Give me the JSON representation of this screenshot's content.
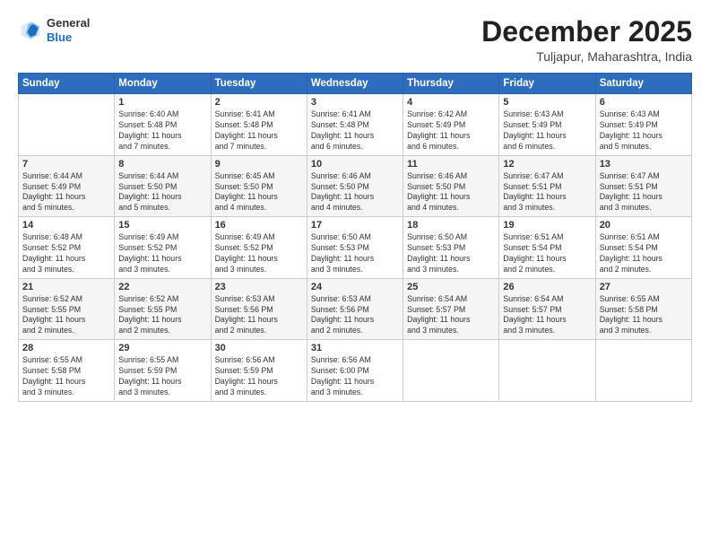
{
  "header": {
    "logo_line1": "General",
    "logo_line2": "Blue",
    "month": "December 2025",
    "location": "Tuljapur, Maharashtra, India"
  },
  "days_of_week": [
    "Sunday",
    "Monday",
    "Tuesday",
    "Wednesday",
    "Thursday",
    "Friday",
    "Saturday"
  ],
  "weeks": [
    [
      {
        "day": "",
        "info": ""
      },
      {
        "day": "1",
        "info": "Sunrise: 6:40 AM\nSunset: 5:48 PM\nDaylight: 11 hours\nand 7 minutes."
      },
      {
        "day": "2",
        "info": "Sunrise: 6:41 AM\nSunset: 5:48 PM\nDaylight: 11 hours\nand 7 minutes."
      },
      {
        "day": "3",
        "info": "Sunrise: 6:41 AM\nSunset: 5:48 PM\nDaylight: 11 hours\nand 6 minutes."
      },
      {
        "day": "4",
        "info": "Sunrise: 6:42 AM\nSunset: 5:49 PM\nDaylight: 11 hours\nand 6 minutes."
      },
      {
        "day": "5",
        "info": "Sunrise: 6:43 AM\nSunset: 5:49 PM\nDaylight: 11 hours\nand 6 minutes."
      },
      {
        "day": "6",
        "info": "Sunrise: 6:43 AM\nSunset: 5:49 PM\nDaylight: 11 hours\nand 5 minutes."
      }
    ],
    [
      {
        "day": "7",
        "info": "Sunrise: 6:44 AM\nSunset: 5:49 PM\nDaylight: 11 hours\nand 5 minutes."
      },
      {
        "day": "8",
        "info": "Sunrise: 6:44 AM\nSunset: 5:50 PM\nDaylight: 11 hours\nand 5 minutes."
      },
      {
        "day": "9",
        "info": "Sunrise: 6:45 AM\nSunset: 5:50 PM\nDaylight: 11 hours\nand 4 minutes."
      },
      {
        "day": "10",
        "info": "Sunrise: 6:46 AM\nSunset: 5:50 PM\nDaylight: 11 hours\nand 4 minutes."
      },
      {
        "day": "11",
        "info": "Sunrise: 6:46 AM\nSunset: 5:50 PM\nDaylight: 11 hours\nand 4 minutes."
      },
      {
        "day": "12",
        "info": "Sunrise: 6:47 AM\nSunset: 5:51 PM\nDaylight: 11 hours\nand 3 minutes."
      },
      {
        "day": "13",
        "info": "Sunrise: 6:47 AM\nSunset: 5:51 PM\nDaylight: 11 hours\nand 3 minutes."
      }
    ],
    [
      {
        "day": "14",
        "info": "Sunrise: 6:48 AM\nSunset: 5:52 PM\nDaylight: 11 hours\nand 3 minutes."
      },
      {
        "day": "15",
        "info": "Sunrise: 6:49 AM\nSunset: 5:52 PM\nDaylight: 11 hours\nand 3 minutes."
      },
      {
        "day": "16",
        "info": "Sunrise: 6:49 AM\nSunset: 5:52 PM\nDaylight: 11 hours\nand 3 minutes."
      },
      {
        "day": "17",
        "info": "Sunrise: 6:50 AM\nSunset: 5:53 PM\nDaylight: 11 hours\nand 3 minutes."
      },
      {
        "day": "18",
        "info": "Sunrise: 6:50 AM\nSunset: 5:53 PM\nDaylight: 11 hours\nand 3 minutes."
      },
      {
        "day": "19",
        "info": "Sunrise: 6:51 AM\nSunset: 5:54 PM\nDaylight: 11 hours\nand 2 minutes."
      },
      {
        "day": "20",
        "info": "Sunrise: 6:51 AM\nSunset: 5:54 PM\nDaylight: 11 hours\nand 2 minutes."
      }
    ],
    [
      {
        "day": "21",
        "info": "Sunrise: 6:52 AM\nSunset: 5:55 PM\nDaylight: 11 hours\nand 2 minutes."
      },
      {
        "day": "22",
        "info": "Sunrise: 6:52 AM\nSunset: 5:55 PM\nDaylight: 11 hours\nand 2 minutes."
      },
      {
        "day": "23",
        "info": "Sunrise: 6:53 AM\nSunset: 5:56 PM\nDaylight: 11 hours\nand 2 minutes."
      },
      {
        "day": "24",
        "info": "Sunrise: 6:53 AM\nSunset: 5:56 PM\nDaylight: 11 hours\nand 2 minutes."
      },
      {
        "day": "25",
        "info": "Sunrise: 6:54 AM\nSunset: 5:57 PM\nDaylight: 11 hours\nand 3 minutes."
      },
      {
        "day": "26",
        "info": "Sunrise: 6:54 AM\nSunset: 5:57 PM\nDaylight: 11 hours\nand 3 minutes."
      },
      {
        "day": "27",
        "info": "Sunrise: 6:55 AM\nSunset: 5:58 PM\nDaylight: 11 hours\nand 3 minutes."
      }
    ],
    [
      {
        "day": "28",
        "info": "Sunrise: 6:55 AM\nSunset: 5:58 PM\nDaylight: 11 hours\nand 3 minutes."
      },
      {
        "day": "29",
        "info": "Sunrise: 6:55 AM\nSunset: 5:59 PM\nDaylight: 11 hours\nand 3 minutes."
      },
      {
        "day": "30",
        "info": "Sunrise: 6:56 AM\nSunset: 5:59 PM\nDaylight: 11 hours\nand 3 minutes."
      },
      {
        "day": "31",
        "info": "Sunrise: 6:56 AM\nSunset: 6:00 PM\nDaylight: 11 hours\nand 3 minutes."
      },
      {
        "day": "",
        "info": ""
      },
      {
        "day": "",
        "info": ""
      },
      {
        "day": "",
        "info": ""
      }
    ]
  ]
}
